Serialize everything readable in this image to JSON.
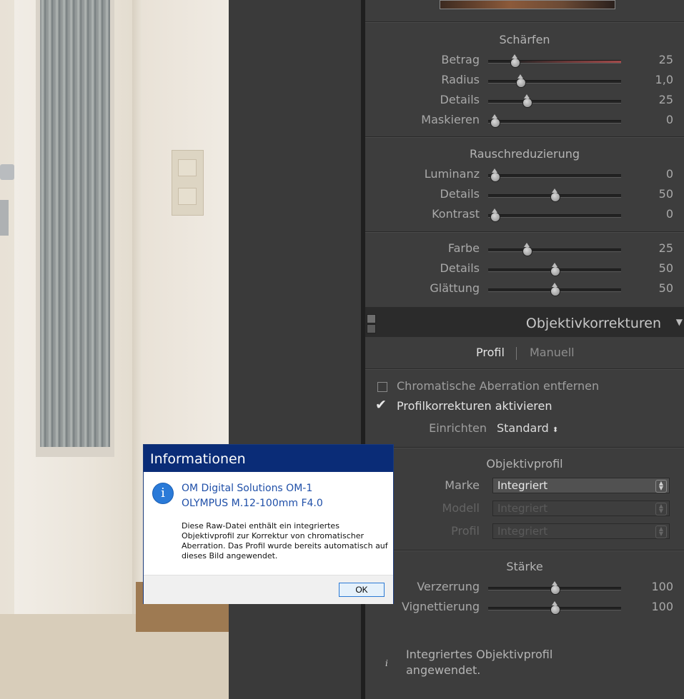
{
  "sharpen": {
    "title": "Schärfen",
    "rows": [
      {
        "label": "Betrag",
        "value": "25",
        "level": 0.2
      },
      {
        "label": "Radius",
        "value": "1,0",
        "level": 0.24
      },
      {
        "label": "Details",
        "value": "25",
        "level": 0.29
      },
      {
        "label": "Maskieren",
        "value": "0",
        "level": 0.05
      }
    ]
  },
  "noise": {
    "title": "Rauschreduzierung",
    "luma": [
      {
        "label": "Luminanz",
        "value": "0",
        "level": 0.05
      },
      {
        "label": "Details",
        "value": "50",
        "level": 0.5
      },
      {
        "label": "Kontrast",
        "value": "0",
        "level": 0.05
      }
    ],
    "color": [
      {
        "label": "Farbe",
        "value": "25",
        "level": 0.29
      },
      {
        "label": "Details",
        "value": "50",
        "level": 0.5
      },
      {
        "label": "Glättung",
        "value": "50",
        "level": 0.5
      }
    ]
  },
  "lens": {
    "header": "Objektivkorrekturen",
    "tab_profile": "Profil",
    "tab_manual": "Manuell",
    "ca_label": "Chromatische Aberration entfernen",
    "profile_label": "Profilkorrekturen aktivieren",
    "setup_label": "Einrichten",
    "setup_value": "Standard",
    "setup_arrow": "⬍",
    "profile_title": "Objektivprofil",
    "make_label": "Marke",
    "make_value": "Integriert",
    "model_label": "Modell",
    "model_value": "Integriert",
    "prof_label": "Profil",
    "prof_value": "Integriert",
    "amount_title": "Stärke",
    "amount": [
      {
        "label": "Verzerrung",
        "value": "100",
        "level": 0.5
      },
      {
        "label": "Vignettierung",
        "value": "100",
        "level": 0.5
      }
    ],
    "info_icon": "i",
    "info_text": "Integriertes Objektivprofil angewendet."
  },
  "dialog": {
    "title": "Informationen",
    "icon": "i",
    "line1": "OM Digital Solutions OM-1",
    "line2": "OLYMPUS M.12-100mm F4.0",
    "body": "Diese Raw-Datei enthält ein integriertes Objektivprofil zur Korrektur von chromatischer Aberration. Das Profil wurde bereits automatisch auf dieses Bild angewendet.",
    "ok_label": "OK"
  }
}
